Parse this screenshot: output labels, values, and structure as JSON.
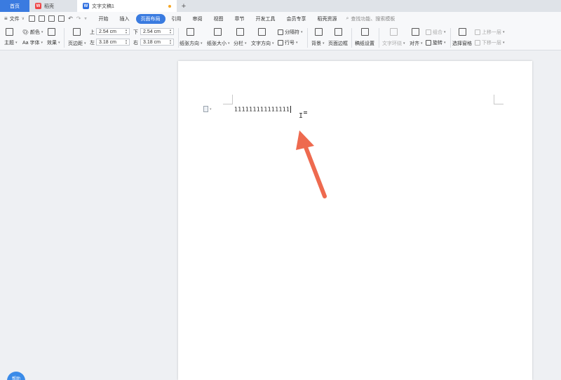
{
  "tabs": {
    "home": "首页",
    "daoke": "稻壳",
    "doc": "文字文稿1",
    "add": "+"
  },
  "menu": {
    "file": "文件",
    "items": [
      "开始",
      "插入",
      "页面布局",
      "引用",
      "审阅",
      "视图",
      "章节",
      "开发工具",
      "会员专享",
      "稻壳资源"
    ],
    "active_index": 2,
    "search_placeholder": "查找功能、搜索模板"
  },
  "ribbon": {
    "theme": "主题",
    "color": "颜色",
    "font": "Aa 字体",
    "effect": "效果",
    "page_margin": "页边距",
    "margin_top_label": "上",
    "margin_top": "2.54 cm",
    "margin_bottom_label": "下",
    "margin_bottom": "2.54 cm",
    "margin_left_label": "左",
    "margin_left": "3.18 cm",
    "margin_right_label": "右",
    "margin_right": "3.18 cm",
    "orientation": "纸张方向",
    "size": "纸张大小",
    "columns": "分栏",
    "text_direction": "文字方向",
    "separator": "分隔符",
    "line_number": "行号",
    "background": "背景",
    "page_border": "页面边框",
    "draft_settings": "稿纸设置",
    "text_wrap": "文字环绕",
    "align": "对齐",
    "rotate": "旋转",
    "group": "组合",
    "select_pane": "选择窗格",
    "bring_forward": "上移一层",
    "send_backward": "下移一层"
  },
  "document": {
    "text": "111111111111111"
  },
  "float_help": "帮助",
  "colors": {
    "accent": "#3a7be0",
    "arrow": "#ee6a4f"
  },
  "icons": [
    "menu-icon",
    "save-icon",
    "undo-icon",
    "redo-icon",
    "search-icon",
    "page-icon",
    "ibeam-cursor-icon",
    "arrow-annotation-icon"
  ]
}
